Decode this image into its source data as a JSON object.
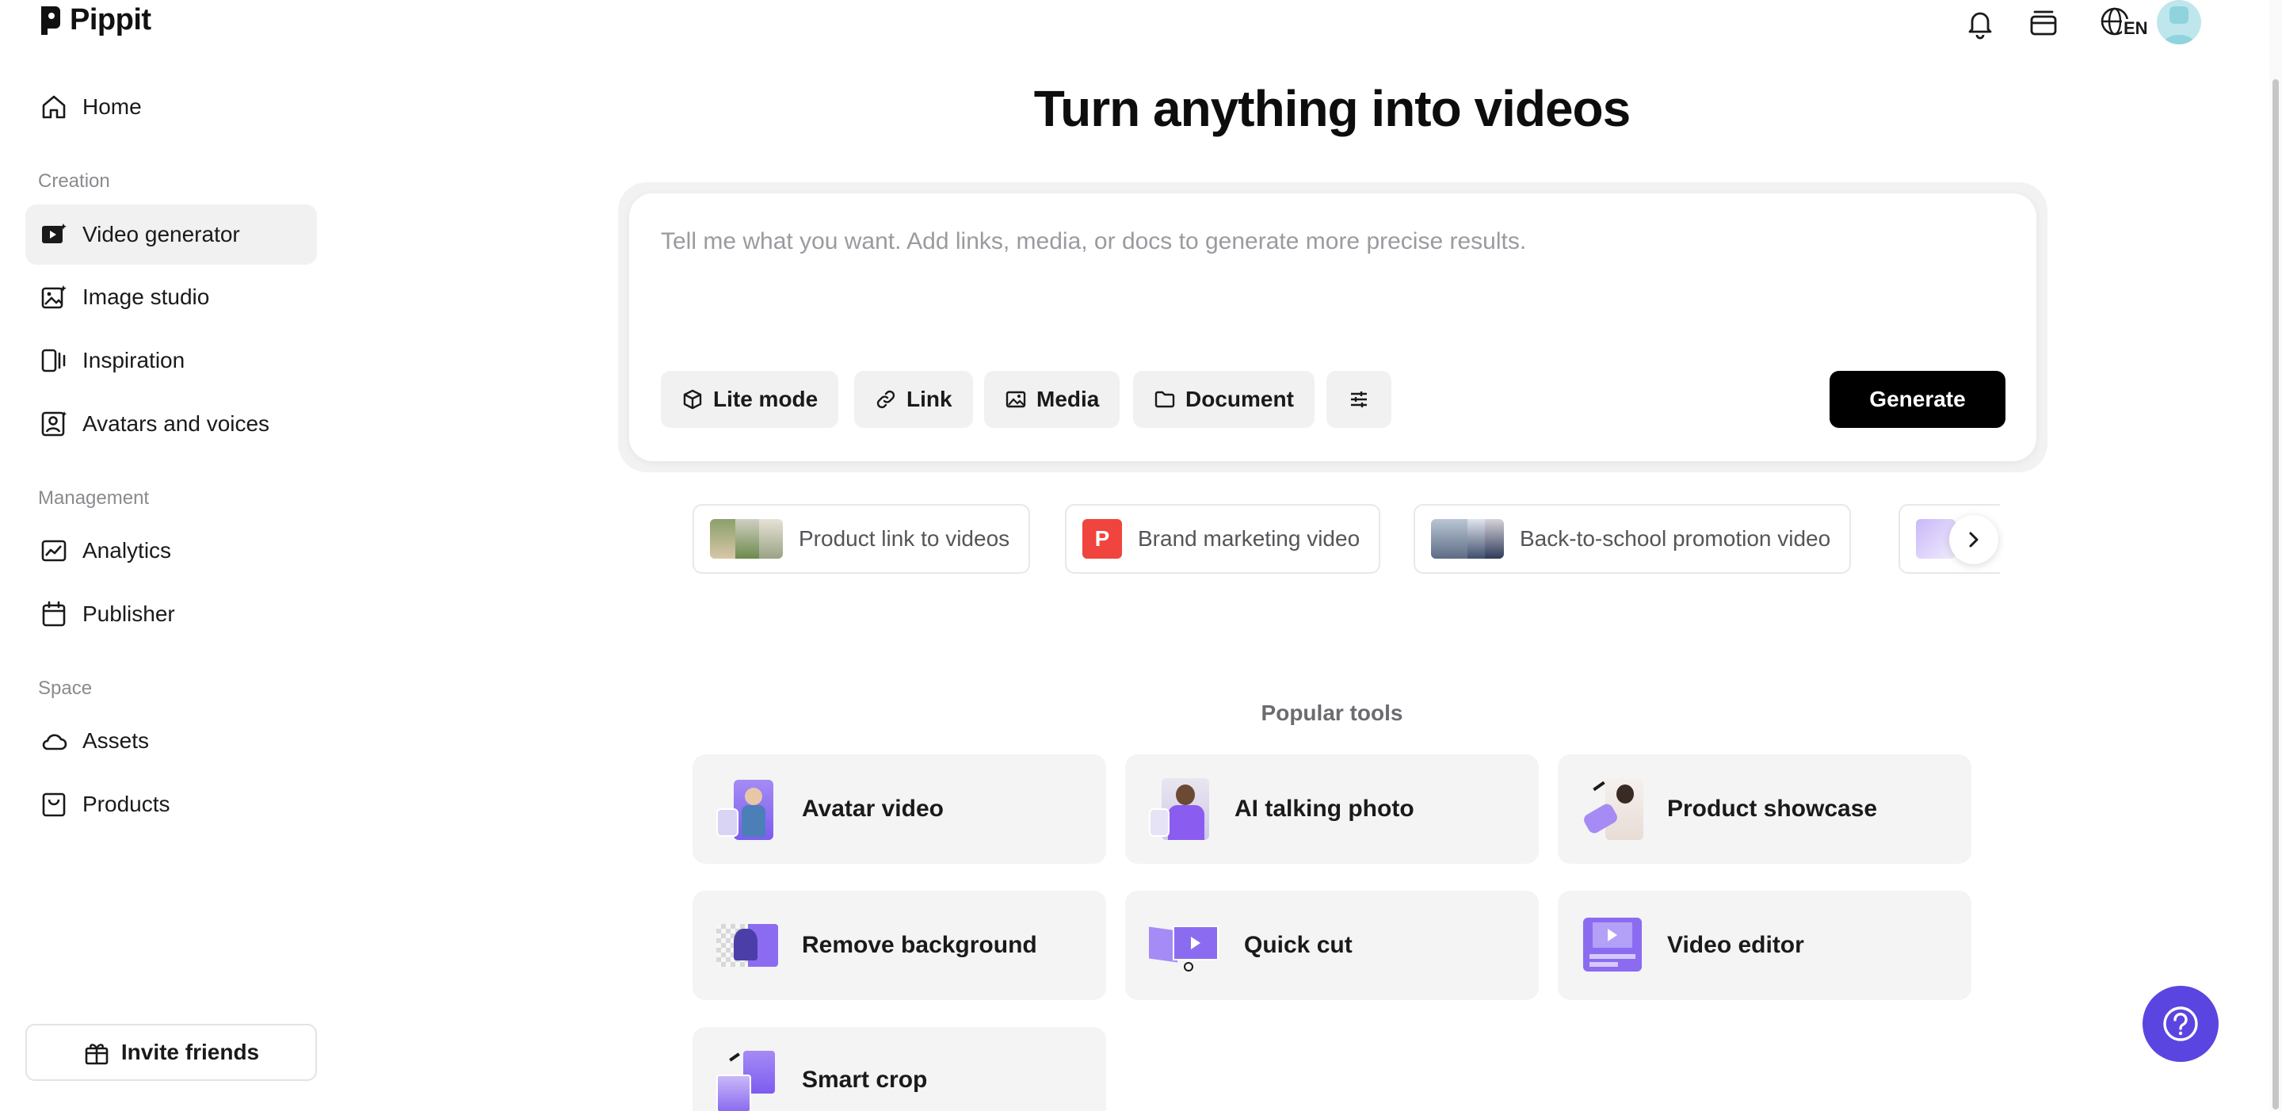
{
  "app": {
    "name": "Pippit"
  },
  "sidebar": {
    "home": {
      "label": "Home",
      "icon": "home-icon"
    },
    "sections": [
      {
        "title": "Creation",
        "items": [
          {
            "label": "Video generator",
            "icon": "video-play-icon",
            "active": true
          },
          {
            "label": "Image studio",
            "icon": "image-sparkle-icon"
          },
          {
            "label": "Inspiration",
            "icon": "inspiration-icon"
          },
          {
            "label": "Avatars and voices",
            "icon": "avatar-icon"
          }
        ]
      },
      {
        "title": "Management",
        "items": [
          {
            "label": "Analytics",
            "icon": "analytics-icon"
          },
          {
            "label": "Publisher",
            "icon": "calendar-icon"
          }
        ]
      },
      {
        "title": "Space",
        "items": [
          {
            "label": "Assets",
            "icon": "cloud-icon"
          },
          {
            "label": "Products",
            "icon": "product-bag-icon"
          }
        ]
      }
    ],
    "invite": {
      "label": "Invite friends",
      "icon": "gift-icon"
    }
  },
  "topbar": {
    "language": "EN",
    "icons": [
      "bell-icon",
      "subscription-icon",
      "globe-icon",
      "avatar"
    ]
  },
  "main": {
    "title": "Turn anything into videos",
    "prompt": {
      "placeholder": "Tell me what you want. Add links, media, or docs to generate more precise results.",
      "value": ""
    },
    "chips": [
      {
        "label": "Lite mode",
        "icon": "cube-icon"
      },
      {
        "label": "Link",
        "icon": "link-icon"
      },
      {
        "label": "Media",
        "icon": "image-icon"
      },
      {
        "label": "Document",
        "icon": "folder-icon"
      },
      {
        "label": "",
        "icon": "settings-sliders-icon"
      }
    ],
    "generate_label": "Generate",
    "suggestions": [
      {
        "label": "Product link to videos"
      },
      {
        "label": "Brand marketing video",
        "badge": "P"
      },
      {
        "label": "Back-to-school promotion video"
      }
    ],
    "popular_title": "Popular tools",
    "tools": [
      {
        "label": "Avatar video"
      },
      {
        "label": "AI talking photo"
      },
      {
        "label": "Product showcase"
      },
      {
        "label": "Remove background"
      },
      {
        "label": "Quick cut"
      },
      {
        "label": "Video editor"
      },
      {
        "label": "Smart crop"
      }
    ]
  },
  "colors": {
    "accent": "#5b45e0",
    "purple_thumb": "#8b6cf0",
    "badge_red": "#f0443e",
    "primary_button": "#000000",
    "active_nav": "#f1f1f2"
  }
}
